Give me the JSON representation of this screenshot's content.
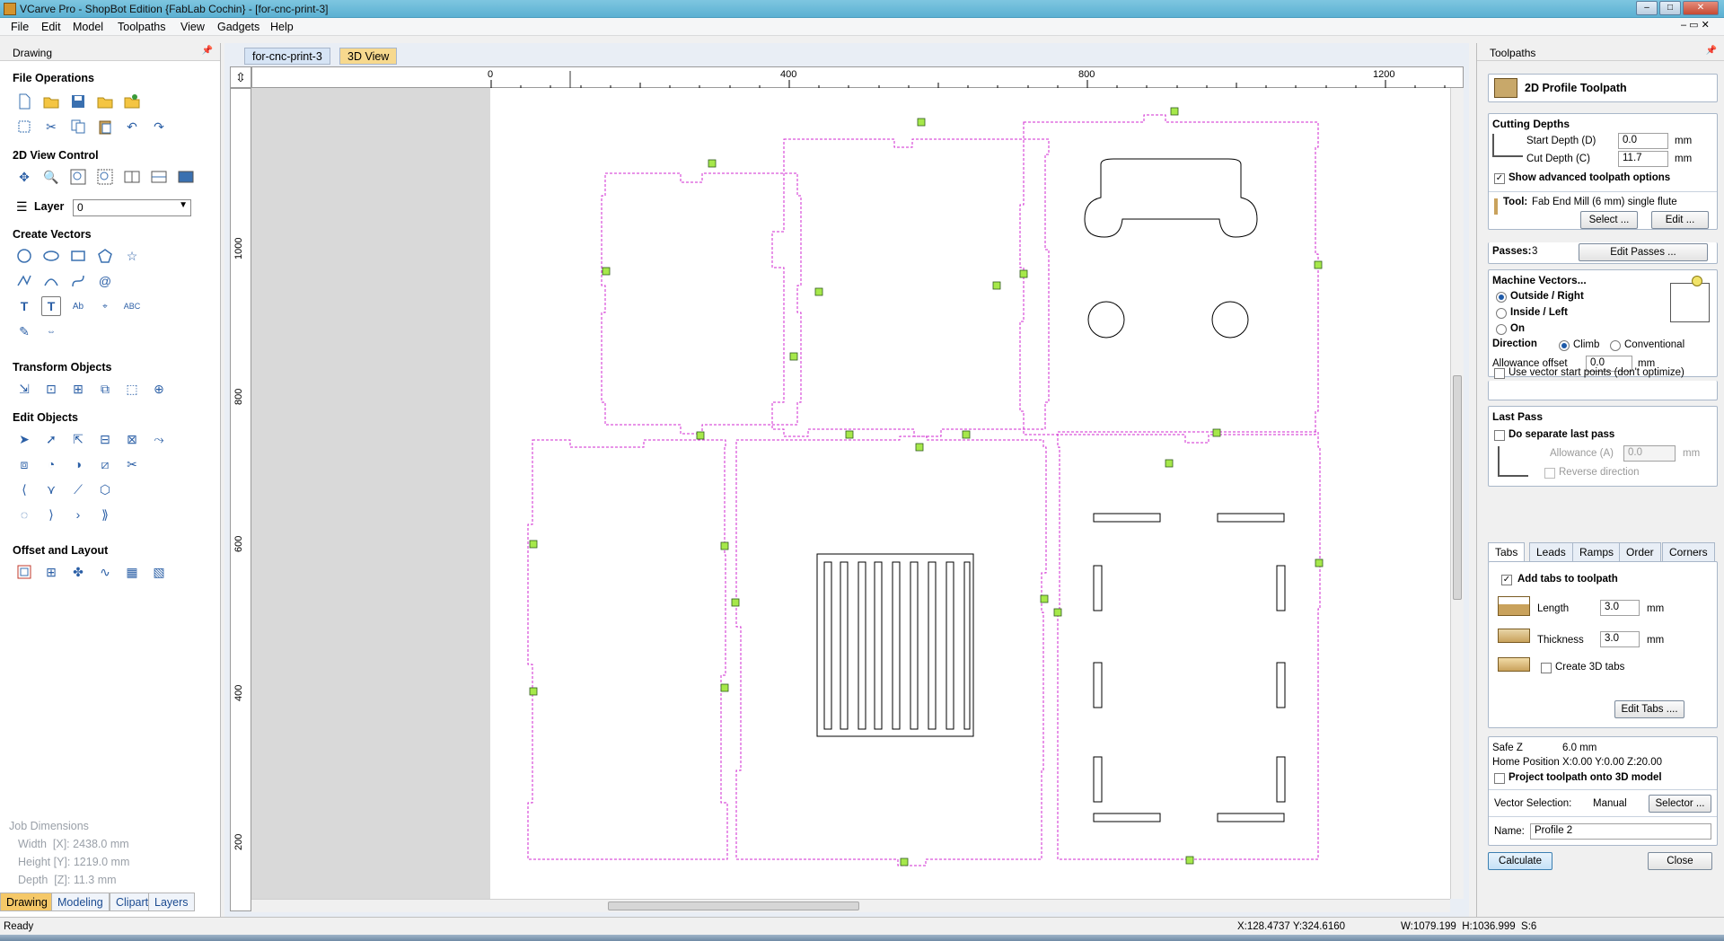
{
  "window": {
    "title": "VCarve Pro - ShopBot Edition {FabLab Cochin} - [for-cnc-print-3]"
  },
  "menu": [
    "File",
    "Edit",
    "Model",
    "Toolpaths",
    "View",
    "Gadgets",
    "Help"
  ],
  "left_panel": {
    "title": "Drawing",
    "sections": {
      "file_ops": "File Operations",
      "view_control": "2D View Control",
      "create_vectors": "Create Vectors",
      "transform": "Transform Objects",
      "edit_objects": "Edit Objects",
      "offset_layout": "Offset and Layout"
    },
    "layer_label": "Layer",
    "layer_value": "0",
    "job_dimensions": {
      "title": "Job Dimensions",
      "width": "Width  [X]: 2438.0 mm",
      "height": "Height [Y]: 1219.0 mm",
      "depth": "Depth  [Z]: 11.3 mm"
    },
    "bottom_tabs": [
      "Drawing",
      "Modeling",
      "Clipart",
      "Layers"
    ]
  },
  "document": {
    "tabs": [
      "for-cnc-print-3",
      "3D View"
    ],
    "ruler_h": [
      "0",
      "400",
      "800",
      "1200"
    ],
    "ruler_v": [
      "1000",
      "800",
      "600",
      "400",
      "200"
    ]
  },
  "right_panel": {
    "title": "Toolpaths",
    "toolpath_name": "2D Profile Toolpath",
    "cutting_depths": {
      "title": "Cutting Depths",
      "start_label": "Start Depth (D)",
      "start_value": "0.0",
      "cut_label": "Cut Depth (C)",
      "cut_value": "11.7",
      "unit": "mm",
      "show_advanced": "Show advanced toolpath options"
    },
    "tool": {
      "label": "Tool:",
      "name": "Fab End Mill (6 mm) single flute",
      "select_btn": "Select ...",
      "edit_btn": "Edit ..."
    },
    "passes": {
      "label": "Passes:",
      "value": "3",
      "button": "Edit Passes ..."
    },
    "machine_vectors": {
      "title": "Machine Vectors...",
      "options": [
        "Outside / Right",
        "Inside / Left",
        "On"
      ],
      "direction_label": "Direction",
      "climb": "Climb",
      "conventional": "Conventional",
      "allowance_label": "Allowance offset",
      "allowance_value": "0.0",
      "use_start": "Use vector start points (don't optimize)"
    },
    "last_pass": {
      "title": "Last Pass",
      "separate": "Do separate last pass",
      "allowance_label": "Allowance (A)",
      "allowance_value": "0.0",
      "unit": "mm",
      "reverse": "Reverse direction"
    },
    "tabs": [
      "Tabs",
      "Leads",
      "Ramps",
      "Order",
      "Corners"
    ],
    "tabs_panel": {
      "add_tabs": "Add tabs to toolpath",
      "length_label": "Length",
      "length_value": "3.0",
      "thickness_label": "Thickness",
      "thickness_value": "3.0",
      "unit": "mm",
      "create_3d": "Create 3D tabs",
      "edit_tabs": "Edit Tabs ...."
    },
    "info": {
      "safe_z_label": "Safe Z",
      "safe_z": "6.0 mm",
      "home_label": "Home Position",
      "home": "X:0.00 Y:0.00 Z:20.00",
      "project": "Project toolpath onto 3D model",
      "vector_sel_label": "Vector Selection:",
      "vector_sel": "Manual",
      "selector_btn": "Selector ...",
      "name_label": "Name:",
      "name_value": "Profile 2"
    },
    "calculate": "Calculate",
    "close": "Close"
  },
  "status": {
    "left": "Ready",
    "coords": "X:128.4737 Y:324.6160",
    "dims": "W:1079.199  H:1036.999  S:6"
  }
}
